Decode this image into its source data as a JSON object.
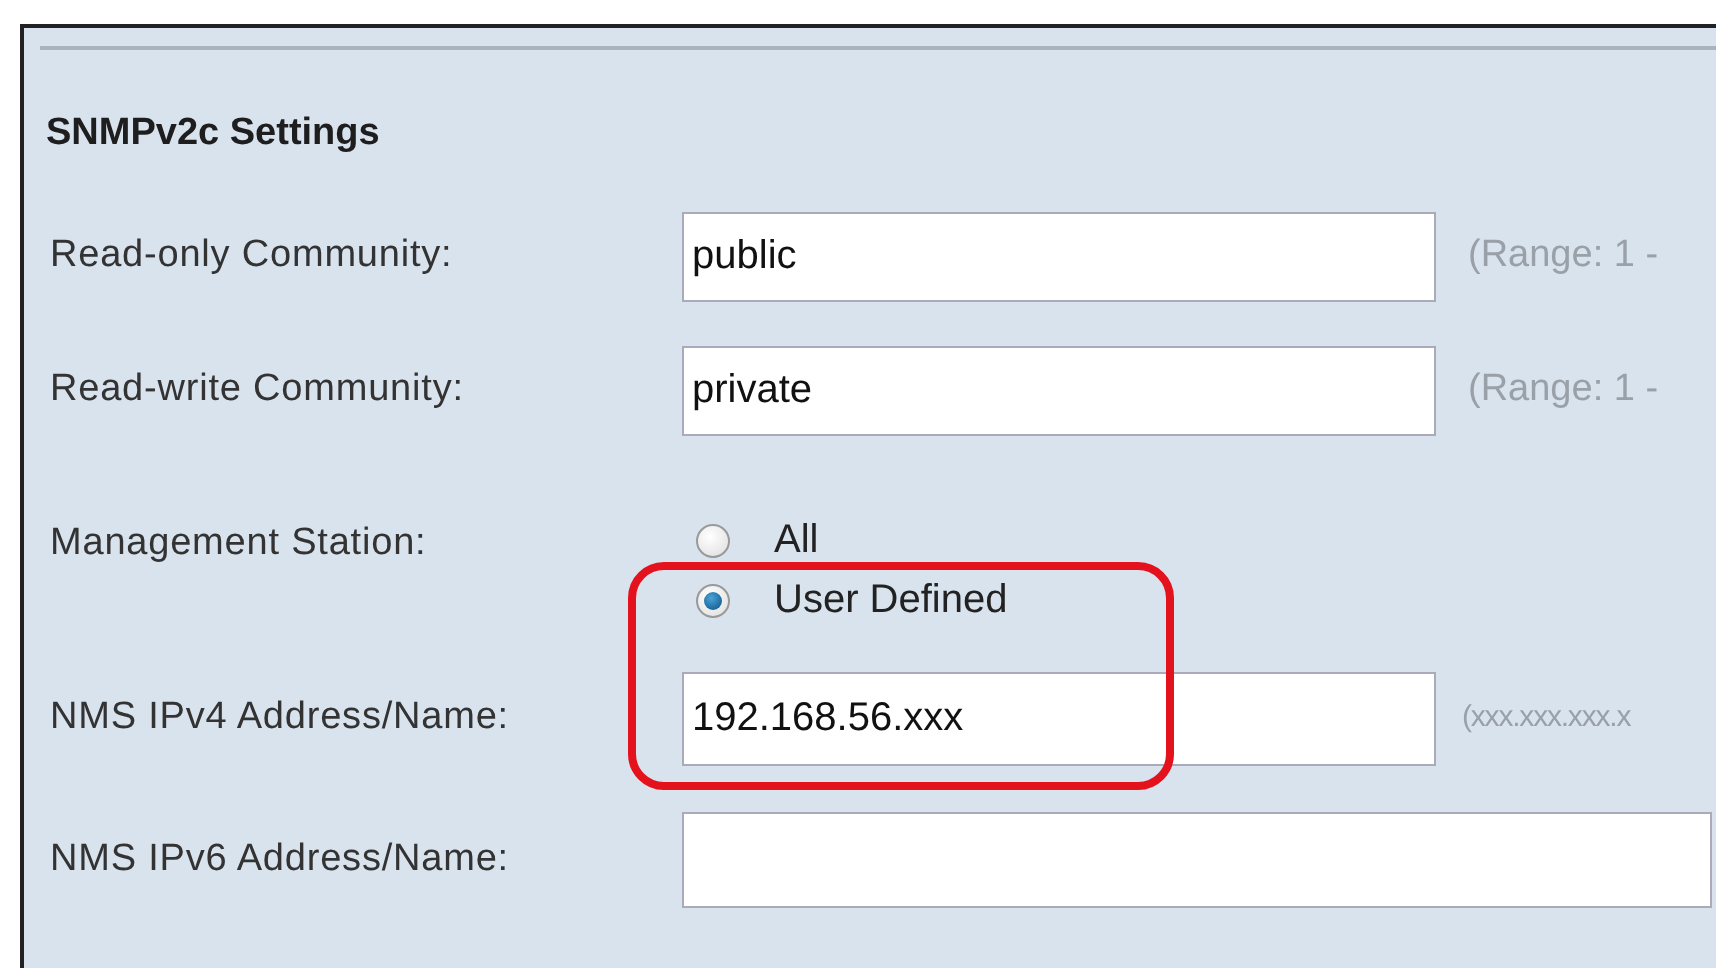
{
  "section": {
    "title": "SNMPv2c Settings"
  },
  "fields": [
    {
      "kind": "text",
      "label": "Read-only Community:",
      "value": "public",
      "hint": "(Range: 1 -"
    },
    {
      "kind": "text",
      "label": "Read-write Community:",
      "value": "private",
      "hint": "(Range: 1 -"
    },
    {
      "kind": "radio",
      "label": "Management Station:",
      "options": [
        {
          "label": "All",
          "selected": false
        },
        {
          "label": "User Defined",
          "selected": true
        }
      ]
    },
    {
      "kind": "text",
      "label": "NMS IPv4 Address/Name:",
      "value": "192.168.56.xxx",
      "hint": "(xxx.xxx.xxx.x",
      "highlighted": true
    },
    {
      "kind": "wide",
      "label": "NMS IPv6 Address/Name:"
    }
  ]
}
